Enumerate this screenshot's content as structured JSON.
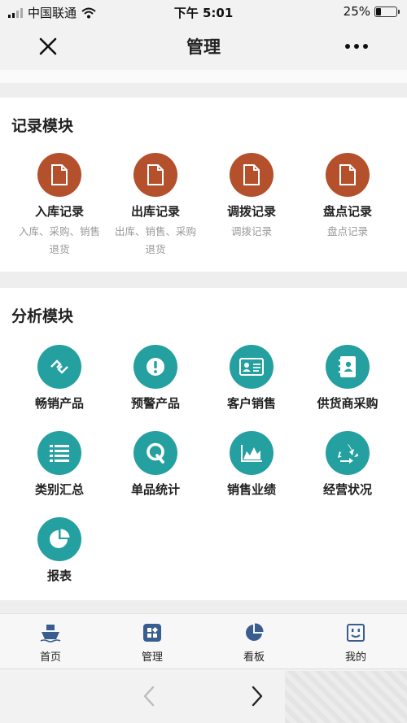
{
  "status_bar": {
    "carrier": "中国联通",
    "time": "下午 5:01",
    "battery": "25%",
    "battery_level": 0.25
  },
  "header": {
    "title": "管理"
  },
  "record_module": {
    "title": "记录模块",
    "items": [
      {
        "label": "入库记录",
        "sub1": "入库、采购、销售",
        "sub2": "退货",
        "icon": "document-icon"
      },
      {
        "label": "出库记录",
        "sub1": "出库、销售、采购",
        "sub2": "退货",
        "icon": "document-icon"
      },
      {
        "label": "调拨记录",
        "sub1": "调拨记录",
        "sub2": "",
        "icon": "document-icon"
      },
      {
        "label": "盘点记录",
        "sub1": "盘点记录",
        "sub2": "",
        "icon": "document-icon"
      }
    ]
  },
  "analysis_module": {
    "title": "分析模块",
    "items": [
      {
        "label": "畅销产品",
        "icon": "link-diamond-icon"
      },
      {
        "label": "预警产品",
        "icon": "alert-icon"
      },
      {
        "label": "客户销售",
        "icon": "id-card-icon"
      },
      {
        "label": "供货商采购",
        "icon": "contacts-book-icon"
      },
      {
        "label": "类别汇总",
        "icon": "list-icon"
      },
      {
        "label": "单品统计",
        "icon": "q-letter-icon"
      },
      {
        "label": "销售业绩",
        "icon": "area-chart-icon"
      },
      {
        "label": "经营状况",
        "icon": "recycle-icon"
      },
      {
        "label": "报表",
        "icon": "pie-chart-icon"
      }
    ]
  },
  "tab_bar": {
    "items": [
      {
        "label": "首页",
        "icon": "ship-icon"
      },
      {
        "label": "管理",
        "icon": "apps-icon"
      },
      {
        "label": "看板",
        "icon": "pie-chart-icon"
      },
      {
        "label": "我的",
        "icon": "face-icon"
      }
    ]
  },
  "colors": {
    "brown_accent": "#b4502c",
    "teal_accent": "#25a0a1",
    "tab_icon": "#3a5d8f"
  }
}
